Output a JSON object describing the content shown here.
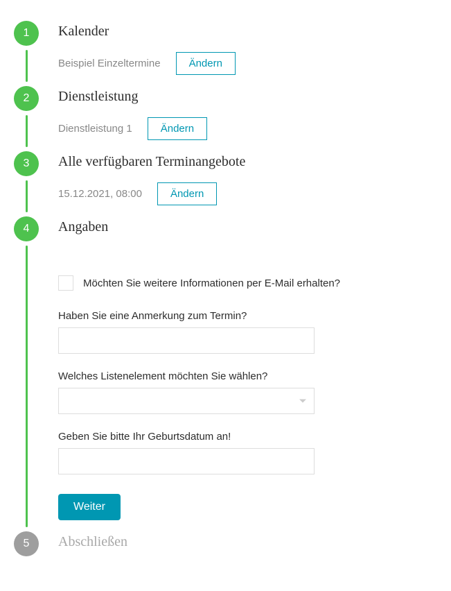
{
  "steps": {
    "s1": {
      "number": "1",
      "title": "Kalender",
      "value": "Beispiel Einzeltermine",
      "changeLabel": "Ändern"
    },
    "s2": {
      "number": "2",
      "title": "Dienstleistung",
      "value": "Dienstleistung 1",
      "changeLabel": "Ändern"
    },
    "s3": {
      "number": "3",
      "title": "Alle verfügbaren Terminangebote",
      "value": "15.12.2021, 08:00",
      "changeLabel": "Ändern"
    },
    "s4": {
      "number": "4",
      "title": "Angaben"
    },
    "s5": {
      "number": "5",
      "title": "Abschließen"
    }
  },
  "form": {
    "emailOptIn": "Möchten Sie weitere Informationen per E-Mail erhalten?",
    "noteLabel": "Haben Sie eine Anmerkung zum Termin?",
    "noteValue": "",
    "listLabel": "Welches Listenelement möchten Sie wählen?",
    "listSelected": "",
    "dobLabel": "Geben Sie bitte Ihr Geburtsdatum an!",
    "dobValue": "",
    "submitLabel": "Weiter"
  }
}
